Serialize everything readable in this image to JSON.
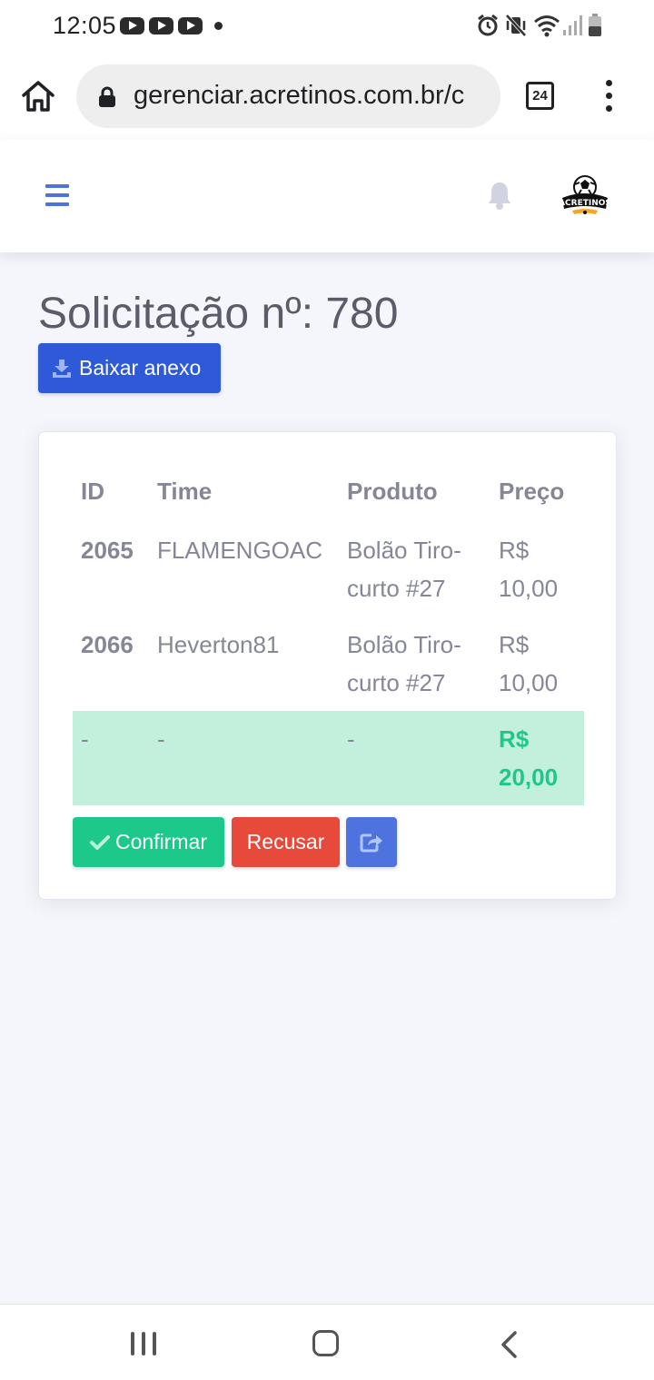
{
  "status_bar": {
    "time": "12:05"
  },
  "browser": {
    "url": "gerenciar.acretinos.com.br/c",
    "tab_count": "24"
  },
  "topbar": {
    "logo_text": "ACRETINOS"
  },
  "page": {
    "title": "Solicitação nº: 780",
    "download_label": "Baixar anexo"
  },
  "table": {
    "headers": {
      "id": "ID",
      "time": "Time",
      "product": "Produto",
      "price": "Preço"
    },
    "rows": [
      {
        "id": "2065",
        "team": "FLAMENGOAC",
        "product": "Bolão Tiro-curto #27",
        "price": "R$ 10,00"
      },
      {
        "id": "2066",
        "team": "Heverton81",
        "product": "Bolão Tiro-curto #27",
        "price": "R$ 10,00"
      }
    ],
    "total": {
      "id": "-",
      "team": "-",
      "product": "-",
      "price": "R$ 20,00"
    }
  },
  "actions": {
    "confirm_label": "Confirmar",
    "reject_label": "Recusar"
  },
  "colors": {
    "primary": "#4e73df",
    "success": "#1cc88a",
    "danger": "#e74a3b",
    "total_row_bg": "#c3f0dd",
    "text_muted": "#858796"
  }
}
